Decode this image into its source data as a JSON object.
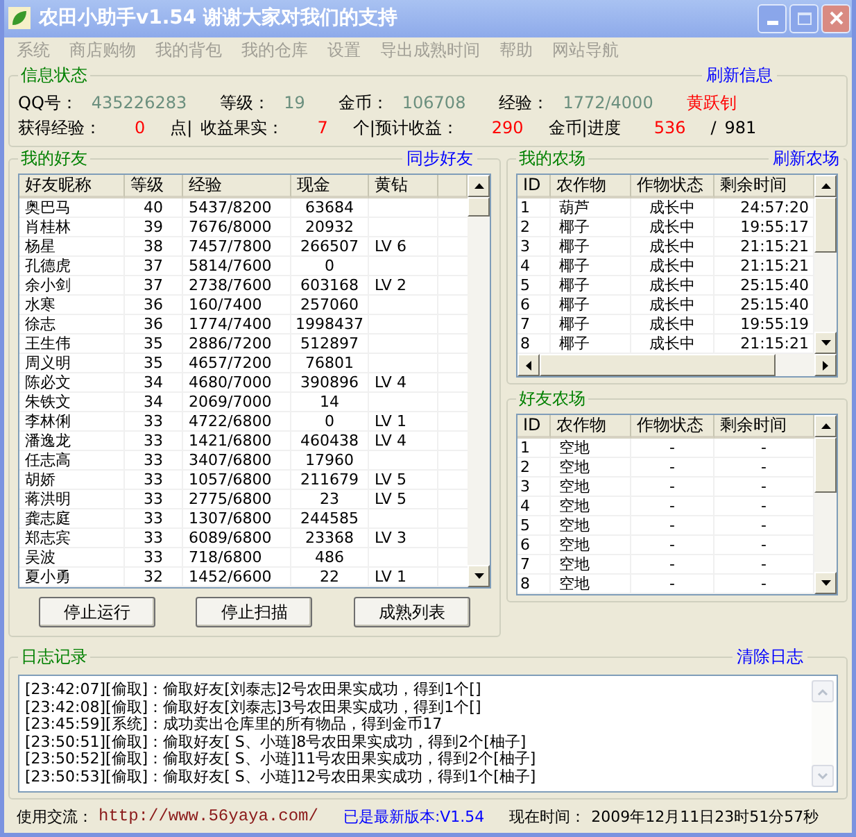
{
  "window": {
    "title": "农田小助手v1.54 谢谢大家对我们的支持"
  },
  "menu": [
    "系统",
    "商店购物",
    "我的背包",
    "我的仓库",
    "设置",
    "导出成熟时间",
    "帮助",
    "网站导航"
  ],
  "info": {
    "title": "信息状态",
    "action": "刷新信息",
    "account_line": [
      {
        "text": "QQ号：",
        "kind": "label"
      },
      {
        "text": "435226283",
        "kind": "value"
      },
      {
        "text": "等级：",
        "kind": "label"
      },
      {
        "text": "19",
        "kind": "value"
      },
      {
        "text": "金币：",
        "kind": "label"
      },
      {
        "text": "106708",
        "kind": "value"
      },
      {
        "text": "经验：",
        "kind": "label"
      },
      {
        "text": "1772/4000",
        "kind": "value"
      },
      {
        "text": "黄跃钊",
        "kind": "alert"
      }
    ],
    "earnings_line": [
      {
        "text": "获得经验：",
        "kind": "label"
      },
      {
        "text": "0",
        "kind": "alert"
      },
      {
        "text": "点|",
        "kind": "label"
      },
      {
        "text": "收益果实：",
        "kind": "label"
      },
      {
        "text": "7",
        "kind": "alert"
      },
      {
        "text": "个|预计收益：",
        "kind": "label"
      },
      {
        "text": "290",
        "kind": "alert"
      },
      {
        "text": "金币|进度",
        "kind": "label"
      },
      {
        "text": "536",
        "kind": "alert"
      },
      {
        "text": "/",
        "kind": "label"
      },
      {
        "text": "981",
        "kind": "label"
      }
    ]
  },
  "friends": {
    "title": "我的好友",
    "action": "同步好友",
    "columns": [
      "好友昵称",
      "等级",
      "经验",
      "现金",
      "黄钻"
    ],
    "rows": [
      [
        "奥巴马",
        "40",
        "5437/8200",
        "63684",
        ""
      ],
      [
        "肖桂林",
        "39",
        "7676/8000",
        "20932",
        ""
      ],
      [
        "杨星",
        "38",
        "7457/7800",
        "266507",
        "LV 6"
      ],
      [
        "孔德虎",
        "37",
        "5814/7600",
        "0",
        ""
      ],
      [
        "余小剑",
        "37",
        "2738/7600",
        "603168",
        "LV 2"
      ],
      [
        "水寒",
        "36",
        "160/7400",
        "257060",
        ""
      ],
      [
        "徐志",
        "36",
        "1774/7400",
        "1998437",
        ""
      ],
      [
        "王生伟",
        "35",
        "2886/7200",
        "512897",
        ""
      ],
      [
        "周义明",
        "35",
        "4657/7200",
        "76801",
        ""
      ],
      [
        "陈必文",
        "34",
        "4680/7000",
        "390896",
        "LV 4"
      ],
      [
        "朱铁文",
        "34",
        "2069/7000",
        "14",
        ""
      ],
      [
        "李林俐",
        "33",
        "4722/6800",
        "0",
        "LV 1"
      ],
      [
        "潘逸龙",
        "33",
        "1421/6800",
        "460438",
        "LV 4"
      ],
      [
        "任志高",
        "33",
        "3407/6800",
        "17960",
        ""
      ],
      [
        "胡娇",
        "33",
        "1057/6800",
        "211679",
        "LV 5"
      ],
      [
        "蒋洪明",
        "33",
        "2775/6800",
        "23",
        "LV 5"
      ],
      [
        "龚志庭",
        "33",
        "1307/6800",
        "244585",
        ""
      ],
      [
        "郑志宾",
        "33",
        "6089/6800",
        "23368",
        "LV 3"
      ],
      [
        "吴波",
        "33",
        "718/6800",
        "486",
        ""
      ],
      [
        "夏小勇",
        "32",
        "1452/6600",
        "22",
        "LV 1"
      ]
    ]
  },
  "buttons": [
    "停止运行",
    "停止扫描",
    "成熟列表"
  ],
  "my_farm": {
    "title": "我的农场",
    "action": "刷新农场",
    "columns": [
      "ID",
      "农作物",
      "作物状态",
      "剩余时间"
    ],
    "rows": [
      [
        "1",
        "葫芦",
        "成长中",
        "24:57:20"
      ],
      [
        "2",
        "椰子",
        "成长中",
        "19:55:17"
      ],
      [
        "3",
        "椰子",
        "成长中",
        "21:15:21"
      ],
      [
        "4",
        "椰子",
        "成长中",
        "21:15:21"
      ],
      [
        "5",
        "椰子",
        "成长中",
        "25:15:40"
      ],
      [
        "6",
        "椰子",
        "成长中",
        "25:15:40"
      ],
      [
        "7",
        "椰子",
        "成长中",
        "19:55:19"
      ],
      [
        "8",
        "椰子",
        "成长中",
        "21:15:21"
      ]
    ]
  },
  "friend_farm": {
    "title": "好友农场",
    "columns": [
      "ID",
      "农作物",
      "作物状态",
      "剩余时间"
    ],
    "rows": [
      [
        "1",
        "空地",
        "-",
        "-"
      ],
      [
        "2",
        "空地",
        "-",
        "-"
      ],
      [
        "3",
        "空地",
        "-",
        "-"
      ],
      [
        "4",
        "空地",
        "-",
        "-"
      ],
      [
        "5",
        "空地",
        "-",
        "-"
      ],
      [
        "6",
        "空地",
        "-",
        "-"
      ],
      [
        "7",
        "空地",
        "-",
        "-"
      ],
      [
        "8",
        "空地",
        "-",
        "-"
      ]
    ]
  },
  "log": {
    "title": "日志记录",
    "action": "清除日志",
    "lines": [
      "[23:42:07][偷取]：偷取好友[刘泰志]2号农田果实成功，得到1个[]",
      "[23:42:08][偷取]：偷取好友[刘泰志]3号农田果实成功，得到1个[]",
      "[23:45:59][系统]：成功卖出仓库里的所有物品，得到金币17",
      "[23:50:51][偷取]：偷取好友[ S、小琏]8号农田果实成功，得到2个[柚子]",
      "[23:50:52][偷取]：偷取好友[ S、小琏]11号农田果实成功，得到2个[柚子]",
      "[23:50:53][偷取]：偷取好友[ S、小琏]12号农田果实成功，得到1个[柚子]"
    ]
  },
  "status_bar": [
    {
      "text": "使用交流：",
      "kind": "label"
    },
    {
      "text": "http://www.56yaya.com/",
      "kind": "link"
    },
    {
      "text": "已是最新版本:V1.54",
      "kind": "version"
    },
    {
      "text": "现在时间：",
      "kind": "label"
    },
    {
      "text": "2009年12月11日23时51分57秒",
      "kind": "label"
    }
  ]
}
